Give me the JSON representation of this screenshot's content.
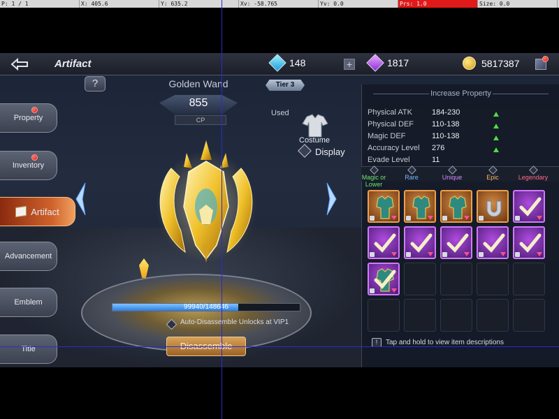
{
  "debug": {
    "pointer": "P: 1 / 1",
    "x": "X: 405.6",
    "y": "Y: 635.2",
    "xv": "Xv: -58.765",
    "yv": "Yv: 0.0",
    "prs": "Prs: 1.0",
    "size": "Size: 0.0"
  },
  "header": {
    "title": "Artifact",
    "diamonds": "148",
    "crystals": "1817",
    "gold": "5817387"
  },
  "tabs": [
    {
      "label": "Property"
    },
    {
      "label": "Inventory"
    },
    {
      "label": "Artifact"
    },
    {
      "label": "Advancement"
    },
    {
      "label": "Emblem"
    },
    {
      "label": "Title"
    }
  ],
  "item": {
    "name": "Golden Wand",
    "cp_value": "855",
    "cp_label": "CP",
    "tier": "Tier 3",
    "used_label": "Used",
    "costume_label": "Costume",
    "display_label": "Display"
  },
  "progress": {
    "text": "99940/148646",
    "fraction": 0.672
  },
  "auto_text": "Auto-Disassemble Unlocks at VIP1",
  "disassemble_label": "Disassemble",
  "panel": {
    "heading": "Increase Property",
    "properties": [
      {
        "name": "Physical ATK",
        "value": "184-230"
      },
      {
        "name": "Physical DEF",
        "value": "110-138"
      },
      {
        "name": "Magic DEF",
        "value": "110-138"
      },
      {
        "name": "Accuracy Level",
        "value": "276"
      },
      {
        "name": "Evade Level",
        "value": "11"
      }
    ]
  },
  "rarities": [
    {
      "label": "Magic or Lower",
      "color": "#6fe36f"
    },
    {
      "label": "Rare",
      "color": "#7ab6ff"
    },
    {
      "label": "Unique",
      "color": "#d48cff"
    },
    {
      "label": "Epic",
      "color": "#ffb65e"
    },
    {
      "label": "Legendary",
      "color": "#ff6a8a"
    }
  ],
  "hint": "Tap and hold to view item descriptions",
  "colors": {
    "orange_frame": "#f0a04c",
    "purple_frame": "#d27aff",
    "progress_fill": "#2e7de2",
    "accent_gold": "#d09a12"
  }
}
